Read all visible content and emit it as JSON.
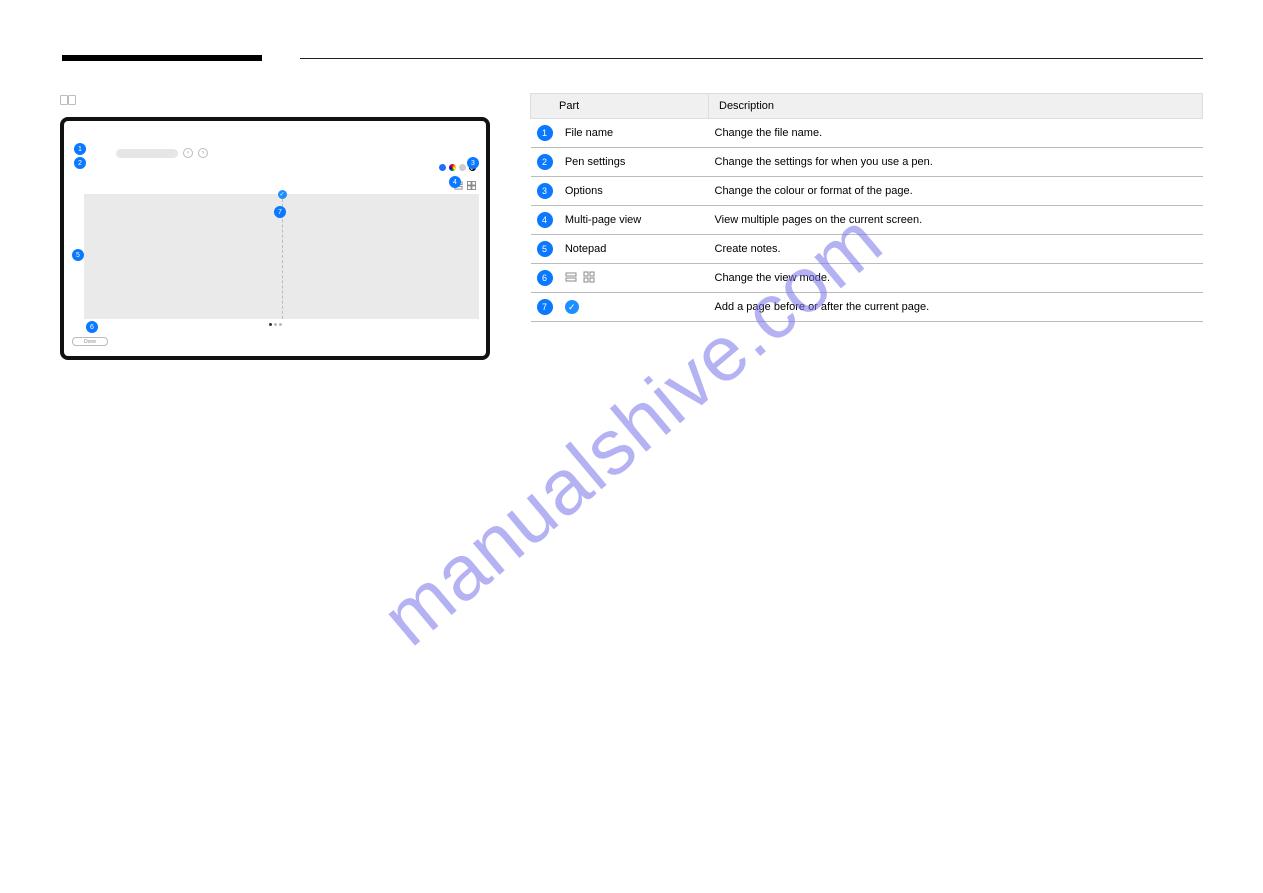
{
  "header": {
    "part_label": "Part",
    "description_label": "Description"
  },
  "rows": [
    {
      "num": "1",
      "part": "File name",
      "desc": "Change the file name."
    },
    {
      "num": "2",
      "part": "Pen settings",
      "desc": "Change the settings for when you use a pen."
    },
    {
      "num": "3",
      "part": "Options",
      "desc": "Change the colour or format of the page."
    },
    {
      "num": "4",
      "part": "Multi-page view",
      "desc": "View multiple pages on the current screen."
    },
    {
      "num": "5",
      "part": "Notepad",
      "desc": "Create notes."
    },
    {
      "num": "6",
      "part": "",
      "desc": "Change the view mode.",
      "icons": true
    },
    {
      "num": "7",
      "part": "",
      "desc": "Add a page before or after the current page.",
      "check": true
    }
  ],
  "device": {
    "done_label": "Done",
    "markers": {
      "m1": "1",
      "m2": "2",
      "m3": "3",
      "m4": "4",
      "m5": "5",
      "m6": "6",
      "m7": "7"
    }
  },
  "watermark": "manualshive.com"
}
